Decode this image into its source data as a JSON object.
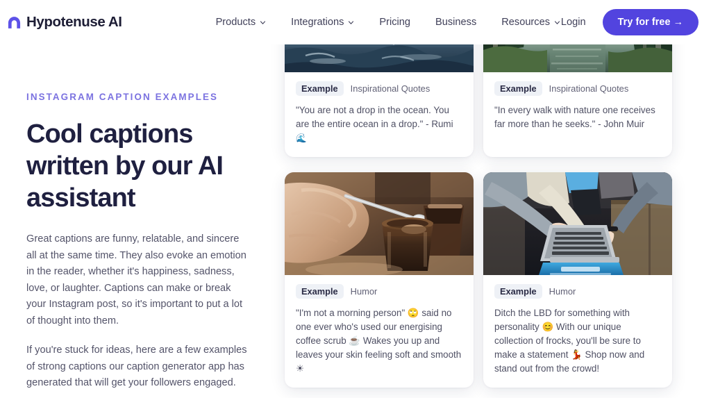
{
  "header": {
    "brand_name": "Hypotenuse AI",
    "brand_icon": "hypotenuse-logo-icon",
    "nav": [
      {
        "label": "Products",
        "has_dropdown": true
      },
      {
        "label": "Integrations",
        "has_dropdown": true
      },
      {
        "label": "Pricing",
        "has_dropdown": false
      },
      {
        "label": "Business",
        "has_dropdown": false
      },
      {
        "label": "Resources",
        "has_dropdown": true
      }
    ],
    "login_label": "Login",
    "cta_label": "Try for free →"
  },
  "hero": {
    "eyebrow": "Instagram Caption Examples",
    "headline": "Cool captions written by our AI assistant",
    "paragraphs": [
      "Great captions are funny, relatable, and sincere all at the same time. They also evoke an emotion in the reader, whether it's happiness, sadness, love, or laughter. Captions can make or break your Instagram post, so it's important to put a lot of thought into them.",
      "If you're stuck for ideas, here are a few examples of strong captions our caption generator app has generated that will get your followers engaged."
    ]
  },
  "cards": [
    {
      "image_name": "ocean-waves-photo",
      "badge": "Example",
      "tag": "Inspirational Quotes",
      "text": "\"You are not a drop in the ocean. You are the entire ocean in a drop.\" - Rumi ",
      "emoji": "🌊"
    },
    {
      "image_name": "forest-lake-photo",
      "badge": "Example",
      "tag": "Inspirational Quotes",
      "text": "\"In every walk with nature one receives far more than he seeks.\" - John Muir",
      "emoji": ""
    },
    {
      "image_name": "coffee-cup-photo",
      "badge": "Example",
      "tag": "Humor",
      "text": "\"I'm not a morning person\" 🙄 said no one ever who's used our energising coffee scrub ☕ Wakes you up and leaves your skin feeling soft and smooth ☀",
      "emoji": ""
    },
    {
      "image_name": "laptop-teamwork-photo",
      "badge": "Example",
      "tag": "Humor",
      "text": "Ditch the LBD for something with personality 😊 With our unique collection of frocks, you'll be sure to make a statement 💃 Shop now and stand out from the crowd!",
      "emoji": ""
    }
  ],
  "colors": {
    "brand_purple": "#5244df",
    "eyebrow_purple": "#7b72e0",
    "headline_dark": "#1f2040",
    "body_gray": "#535369",
    "badge_bg": "#eef1f6",
    "page_bg": "#ffffff"
  }
}
